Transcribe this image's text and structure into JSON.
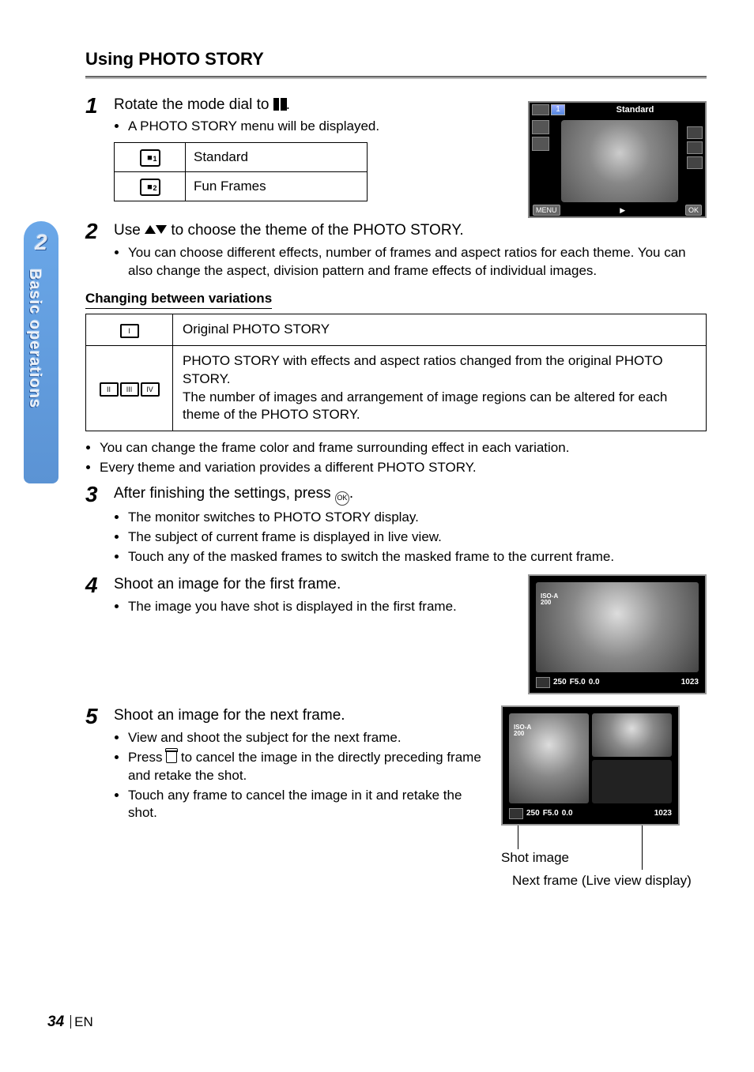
{
  "section_tab": {
    "number": "2",
    "title": "Basic operations"
  },
  "heading": "Using PHOTO STORY",
  "steps": [
    {
      "num": "1",
      "text_pre": "Rotate the mode dial to ",
      "text_post": ".",
      "bullets": [
        "A PHOTO STORY menu will be displayed."
      ],
      "table": {
        "rows": [
          {
            "label": "Standard"
          },
          {
            "label": "Fun Frames"
          }
        ]
      }
    },
    {
      "num": "2",
      "text": "Use △▽ to choose the theme of the PHOTO STORY.",
      "bullets": [
        "You can choose different effects, number of frames and aspect ratios for each theme. You can also change the aspect, division pattern and frame effects of individual images."
      ]
    },
    {
      "num": "3",
      "text": "After finishing the settings, press ",
      "text_post": ".",
      "bullets": [
        "The monitor switches to PHOTO STORY display.",
        "The subject of current frame is displayed in live view.",
        "Touch any of the masked frames to switch the masked frame to the current frame."
      ]
    },
    {
      "num": "4",
      "text": "Shoot an image for the first frame.",
      "bullets": [
        "The image you have shot is displayed in the first frame."
      ]
    },
    {
      "num": "5",
      "text": "Shoot an image for the next frame.",
      "bullets": [
        "View and shoot the subject for the next frame.",
        "Press 🗑 to cancel the image in the directly preceding frame and retake the shot.",
        "Touch any frame to cancel the image in it and retake the shot."
      ]
    }
  ],
  "subhead": "Changing between variations",
  "variations_table": {
    "rows": [
      {
        "cell": "Original PHOTO STORY"
      },
      {
        "cell": "PHOTO STORY with effects and aspect ratios changed from the original PHOTO STORY.\nThe number of images and arrangement of image regions can be altered for each theme of the PHOTO STORY."
      }
    ]
  },
  "after_table_bullets": [
    "You can change the frame color and frame surrounding effect in each variation.",
    "Every theme and variation provides a different PHOTO STORY."
  ],
  "screenshot1": {
    "top_num": "1",
    "top_label": "Standard",
    "bot_left": "MENU",
    "bot_right": "OK"
  },
  "shot_labels": {
    "iso": "ISO-A",
    "iso_val": "200",
    "shutter": "250",
    "fstop": "F5.0",
    "ev": "0.0",
    "remain": "1023"
  },
  "callouts": {
    "shot_image": "Shot image",
    "next_frame": "Next frame (Live view display)"
  },
  "footer": {
    "page": "34",
    "lang": "EN"
  }
}
